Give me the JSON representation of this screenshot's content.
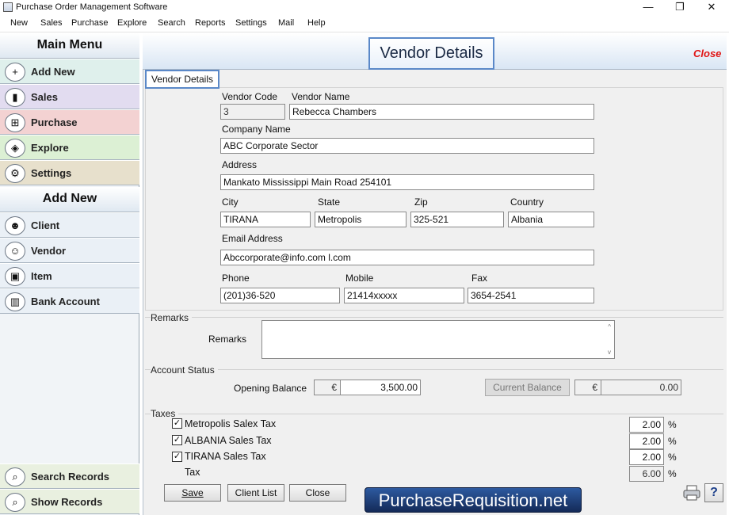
{
  "window": {
    "title": "Purchase Order Management Software",
    "minimize_glyph": "—",
    "restore_glyph": "❐",
    "close_glyph": "✕"
  },
  "menu": [
    "New",
    "Sales",
    "Purchase",
    "Explore",
    "Search",
    "Reports",
    "Settings",
    "Mail",
    "Help"
  ],
  "sidebar": {
    "main_menu_header": "Main Menu",
    "main_items": [
      {
        "label": "Add New",
        "icon": "add-document-icon",
        "glyph": "+",
        "color": "#dff0ec"
      },
      {
        "label": "Sales",
        "icon": "chart-icon",
        "glyph": "▮",
        "color": "#e2dcf0"
      },
      {
        "label": "Purchase",
        "icon": "basket-icon",
        "glyph": "⊞",
        "color": "#f3d2d2"
      },
      {
        "label": "Explore",
        "icon": "explore-icon",
        "glyph": "◈",
        "color": "#dcf0d4"
      },
      {
        "label": "Settings",
        "icon": "gear-icon",
        "glyph": "⚙",
        "color": "#e7e0cc"
      }
    ],
    "add_new_header": "Add New",
    "add_items": [
      {
        "label": "Client",
        "icon": "client-icon",
        "glyph": "☻"
      },
      {
        "label": "Vendor",
        "icon": "vendor-icon",
        "glyph": "☺"
      },
      {
        "label": "Item",
        "icon": "item-bag-icon",
        "glyph": "▣"
      },
      {
        "label": "Bank Account",
        "icon": "bank-icon",
        "glyph": "▥"
      }
    ],
    "bottom_items": [
      {
        "label": "Search Records",
        "icon": "search-records-icon",
        "glyph": "⌕"
      },
      {
        "label": "Show Records",
        "icon": "show-records-icon",
        "glyph": "⌕"
      }
    ]
  },
  "page": {
    "title": "Vendor Details",
    "close_label": "Close",
    "group_tab": "Vendor Details"
  },
  "form": {
    "vendor_code_label": "Vendor Code",
    "vendor_code": "3",
    "vendor_name_label": "Vendor Name",
    "vendor_name": "Rebecca Chambers",
    "company_name_label": "Company Name",
    "company_name": "ABC Corporate Sector",
    "address_label": "Address",
    "address": "Mankato Mississippi Main Road 254101",
    "city_label": "City",
    "city": "TIRANA",
    "state_label": "State",
    "state": "Metropolis",
    "zip_label": "Zip",
    "zip": "325-521",
    "country_label": "Country",
    "country": "Albania",
    "email_label": "Email Address",
    "email": "Abccorporate@info.com     l.com",
    "phone_label": "Phone",
    "phone": "(201)36-520",
    "mobile_label": "Mobile",
    "mobile": "21414xxxxx",
    "fax_label": "Fax",
    "fax": "3654-2541"
  },
  "remarks": {
    "section": "Remarks",
    "label": "Remarks",
    "value": ""
  },
  "account": {
    "section": "Account Status",
    "opening_label": "Opening Balance",
    "currency": "€",
    "opening_value": "3,500.00",
    "current_button": "Current Balance",
    "current_value": "0.00"
  },
  "taxes": {
    "section": "Taxes",
    "items": [
      {
        "label": "Metropolis Salex Tax",
        "checked": true,
        "value": "2.00"
      },
      {
        "label": "ALBANIA Sales Tax",
        "checked": true,
        "value": "2.00"
      },
      {
        "label": "TIRANA Sales Tax",
        "checked": true,
        "value": "2.00"
      }
    ],
    "total_label": "Tax",
    "total_value": "6.00",
    "percent": "%"
  },
  "buttons": {
    "save": "Save",
    "client_list": "Client List",
    "close": "Close",
    "help": "?"
  },
  "brand": "PurchaseRequisition.net"
}
